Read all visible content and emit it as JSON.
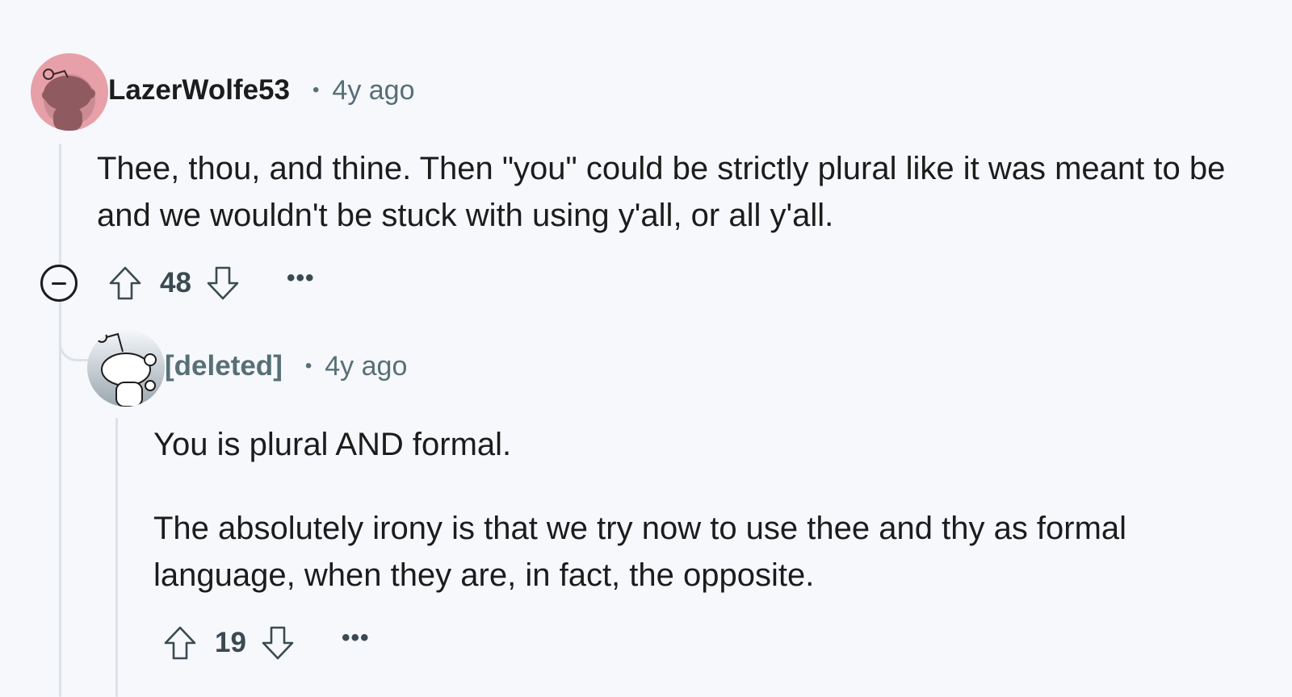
{
  "colors": {
    "background": "#f6f8fb",
    "thread_line": "#dde2e8",
    "meta_text": "#576f76",
    "avatar_main_bg": "#e8a0a8",
    "avatar_reply_bg": "#c7cfd5"
  },
  "comments": [
    {
      "username": "LazerWolfe53",
      "separator": "•",
      "time": "4y ago",
      "body": "Thee, thou, and thine. Then \"you\" could be strictly plural like it was meant to be and we wouldn't be stuck with using y'all, or all y'all.",
      "score": "48",
      "more": "•••",
      "icons": [
        "collapse-icon",
        "upvote-icon",
        "downvote-icon",
        "more-options-icon"
      ]
    },
    {
      "username": "[deleted]",
      "separator": "•",
      "time": "4y ago",
      "body": [
        "You is plural AND formal.",
        "The absolutely irony is that we try now to use thee and thy as formal language, when they are, in fact, the opposite."
      ],
      "score": "19",
      "more": "•••",
      "icons": [
        "upvote-icon",
        "downvote-icon",
        "more-options-icon"
      ]
    }
  ]
}
